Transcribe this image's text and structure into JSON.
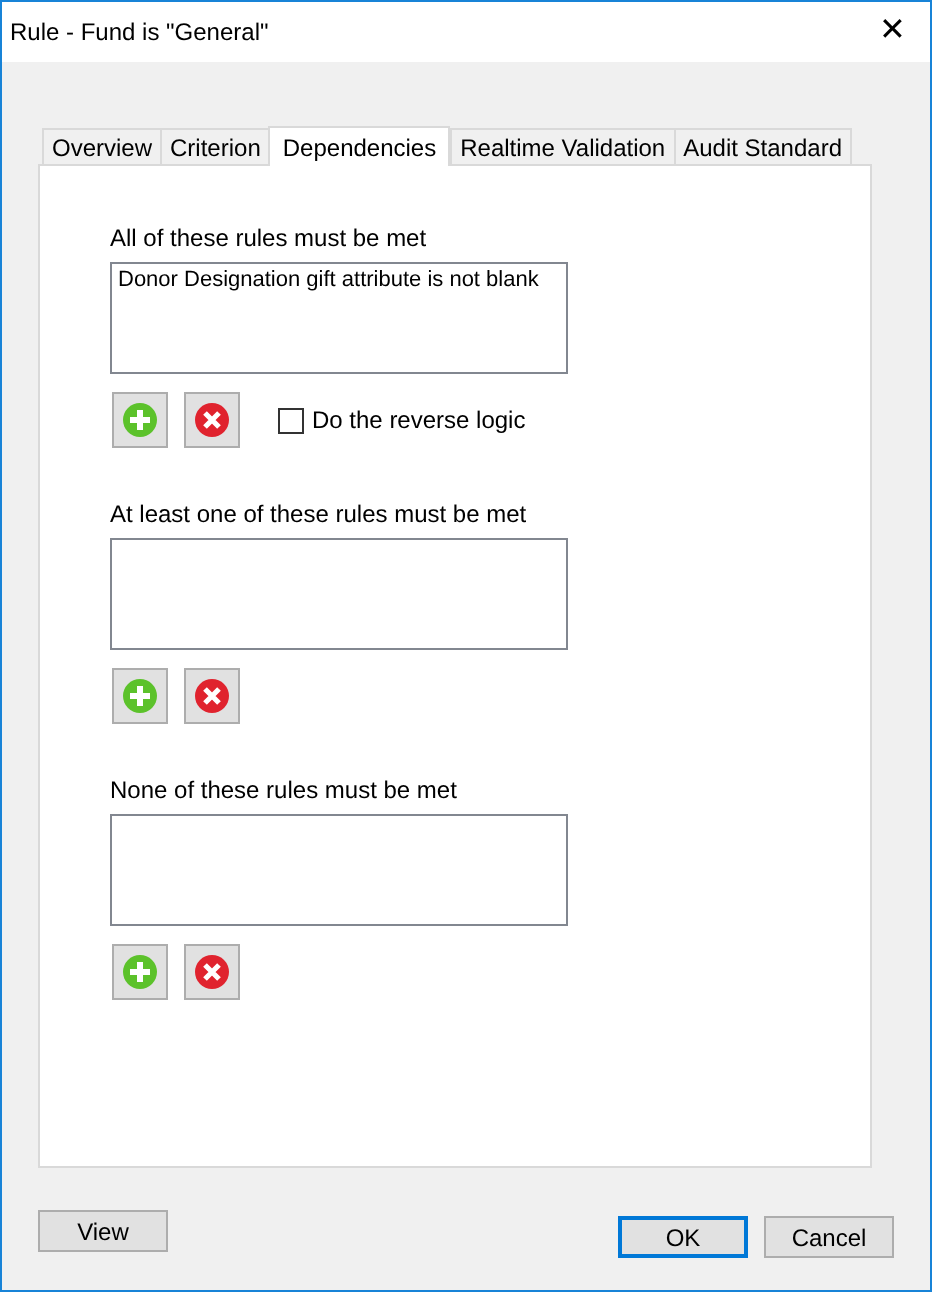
{
  "window": {
    "title": "Rule - Fund is \"General\"",
    "close": "✕"
  },
  "tabs": [
    {
      "label": "Overview",
      "selected": false
    },
    {
      "label": "Criterion",
      "selected": false
    },
    {
      "label": "Dependencies",
      "selected": true
    },
    {
      "label": "Realtime Validation",
      "selected": false
    },
    {
      "label": "Audit Standard",
      "selected": false
    }
  ],
  "sections": [
    {
      "label": "All of these rules must be met",
      "items": [
        "Donor Designation gift attribute is not blank"
      ],
      "checkbox": {
        "label": "Do the reverse logic",
        "checked": false
      }
    },
    {
      "label": "At least one of these rules must be met"
    },
    {
      "label": "None of these rules must be met"
    }
  ],
  "buttons": [
    {
      "label": "View",
      "kind": "left",
      "selected": false
    },
    {
      "label": "OK",
      "kind": "right",
      "selected": true
    },
    {
      "label": "Cancel",
      "kind": "right",
      "selected": false
    }
  ]
}
